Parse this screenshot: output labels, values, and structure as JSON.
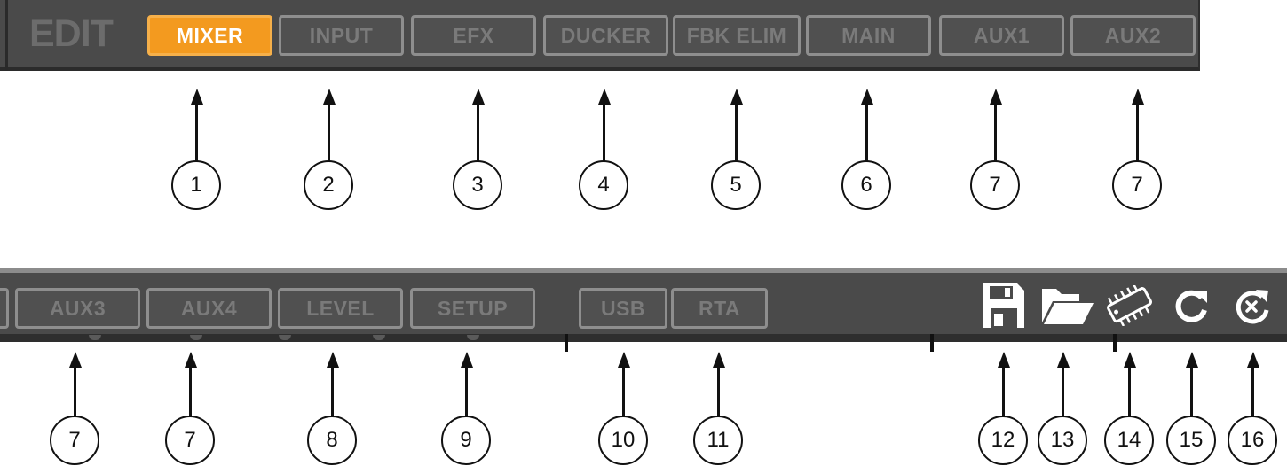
{
  "toolbar_top": {
    "edit_label": "EDIT",
    "tabs": [
      {
        "label": "MIXER",
        "active": true
      },
      {
        "label": "INPUT",
        "active": false
      },
      {
        "label": "EFX",
        "active": false
      },
      {
        "label": "DUCKER",
        "active": false
      },
      {
        "label": "FBK ELIM",
        "active": false
      },
      {
        "label": "MAIN",
        "active": false
      },
      {
        "label": "AUX1",
        "active": false
      },
      {
        "label": "AUX2",
        "active": false
      }
    ]
  },
  "toolbar_bottom": {
    "tabs": [
      {
        "label": "AUX3"
      },
      {
        "label": "AUX4"
      },
      {
        "label": "LEVEL"
      },
      {
        "label": "SETUP"
      },
      {
        "label": "USB"
      },
      {
        "label": "RTA"
      }
    ],
    "icons": [
      "save-icon",
      "open-folder-icon",
      "chip-icon",
      "refresh-icon",
      "reset-icon"
    ]
  },
  "colors": {
    "active_tab": "#f39a1f",
    "bar_background": "#4a4a4a",
    "inactive_text": "#7a7a7a",
    "icon_fill": "#ffffff"
  },
  "callouts_top": [
    "1",
    "2",
    "3",
    "4",
    "5",
    "6",
    "7",
    "7"
  ],
  "callouts_bottom": [
    "7",
    "7",
    "8",
    "9",
    "10",
    "11",
    "12",
    "13",
    "14",
    "15",
    "16"
  ]
}
